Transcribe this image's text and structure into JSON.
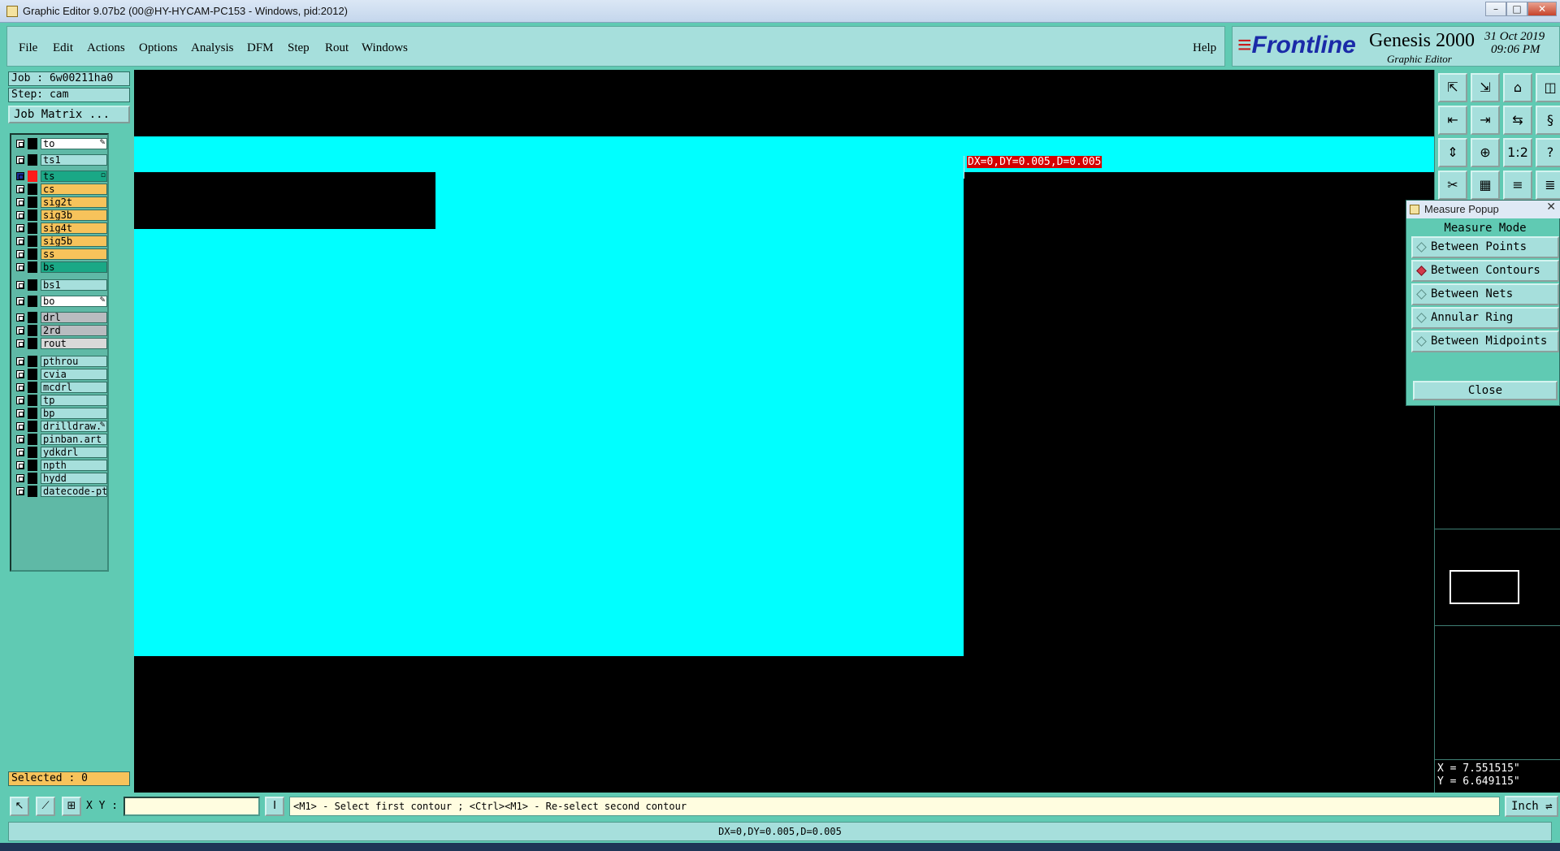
{
  "window": {
    "title": "Graphic Editor 9.07b2 (00@HY-HYCAM-PC153 - Windows, pid:2012)",
    "minimize": "–",
    "maximize": "□",
    "close": "✕"
  },
  "menu": [
    "File",
    "Edit",
    "Actions",
    "Options",
    "Analysis",
    "DFM",
    "Step",
    "Rout",
    "Windows"
  ],
  "help": "Help",
  "brand": {
    "logo": "Frontline",
    "product": "Genesis 2000",
    "subtitle": "Graphic Editor",
    "date": "31 Oct 2019",
    "time": "09:06 PM"
  },
  "job": {
    "job_label": "Job : 6w00211ha0",
    "step_label": "Step: cam",
    "matrix_button": "Job Matrix ..."
  },
  "layers": [
    {
      "name": "to",
      "color": "#ffffff",
      "marker": "✎"
    },
    {
      "name": "ts1",
      "color": "#a6dfdc",
      "marker": ""
    },
    {
      "name": "ts",
      "color": "#1aa886",
      "marker": "▫",
      "active": true
    },
    {
      "name": "cs",
      "color": "#f7c35b",
      "marker": ""
    },
    {
      "name": "sig2t",
      "color": "#f7c35b",
      "marker": ""
    },
    {
      "name": "sig3b",
      "color": "#f7c35b",
      "marker": ""
    },
    {
      "name": "sig4t",
      "color": "#f7c35b",
      "marker": ""
    },
    {
      "name": "sig5b",
      "color": "#f7c35b",
      "marker": ""
    },
    {
      "name": "ss",
      "color": "#f7c35b",
      "marker": ""
    },
    {
      "name": "bs",
      "color": "#1aa886",
      "marker": ""
    },
    {
      "name": "bs1",
      "color": "#a6dfdc",
      "marker": ""
    },
    {
      "name": "bo",
      "color": "#ffffff",
      "marker": "✎"
    },
    {
      "name": "drl",
      "color": "#b9bcc0",
      "marker": ""
    },
    {
      "name": "2rd",
      "color": "#b9bcc0",
      "marker": ""
    },
    {
      "name": "rout",
      "color": "#d9d9d9",
      "marker": ""
    },
    {
      "name": "pthrou",
      "color": "#a6dfdc",
      "marker": ""
    },
    {
      "name": "cvia",
      "color": "#a6dfdc",
      "marker": ""
    },
    {
      "name": "mcdrl",
      "color": "#a6dfdc",
      "marker": ""
    },
    {
      "name": "tp",
      "color": "#a6dfdc",
      "marker": ""
    },
    {
      "name": "bp",
      "color": "#a6dfdc",
      "marker": ""
    },
    {
      "name": "drilldraw.",
      "color": "#a6dfdc",
      "marker": "✎"
    },
    {
      "name": "pinban.art",
      "color": "#a6dfdc",
      "marker": ""
    },
    {
      "name": "ydkdrl",
      "color": "#a6dfdc",
      "marker": ""
    },
    {
      "name": "npth",
      "color": "#a6dfdc",
      "marker": ""
    },
    {
      "name": "hydd",
      "color": "#a6dfdc",
      "marker": ""
    },
    {
      "name": "datecode-pt",
      "color": "#a6dfdc",
      "marker": ""
    }
  ],
  "selected": "Selected : 0",
  "measure_label": "DX=0,DY=0.005,D=0.005",
  "tools": [
    "⇱",
    "⇲",
    "⌂",
    "◫",
    "⇤",
    "⇥",
    "⇆",
    "§",
    "⇕",
    "⊕",
    "1:2",
    "?",
    "✂",
    "▦",
    "≡",
    "≣"
  ],
  "popup": {
    "title": "Measure Popup",
    "close_x": "✕",
    "mode_heading": "Measure Mode",
    "modes": [
      "Between Points",
      "Between Contours",
      "Between Nets",
      "Annular Ring",
      "Between Midpoints"
    ],
    "selected_mode": "Between Contours",
    "close_button": "Close"
  },
  "coords": {
    "x": "X = 7.551515\"",
    "y": "Y = 6.649115\""
  },
  "cmd": {
    "icons": [
      "↖",
      "⟋",
      "⊞"
    ],
    "xy_label": "X Y :",
    "xy_value": "",
    "cursor_icon": "I",
    "prompt": "<M1> - Select first contour ; <Ctrl><M1> - Re-select second contour",
    "units": "Inch ⇌"
  },
  "status": "DX=0,DY=0.005,D=0.005"
}
